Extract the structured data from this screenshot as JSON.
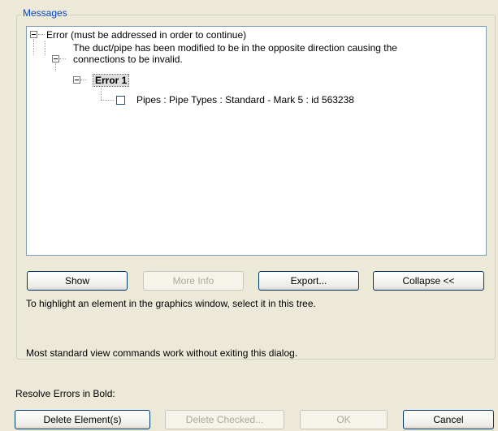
{
  "messages_group": {
    "title": "Messages"
  },
  "tree": {
    "root_label": "Error (must be addressed in order to continue)",
    "message_line1": "The duct/pipe has been modified to be in the opposite direction causing the",
    "message_line2": "connections to be invalid.",
    "error_label": "Error 1",
    "element_label": "Pipes : Pipe Types : Standard - Mark 5 : id 563238",
    "element_checked": false
  },
  "buttons": {
    "show": "Show",
    "more_info": "More Info",
    "export": "Export...",
    "collapse": "Collapse <<"
  },
  "hints": {
    "line1": "To highlight an element in the graphics window, select it in this tree.",
    "line2": "Most standard view commands work without exiting this dialog."
  },
  "resolve": {
    "label": "Resolve Errors in Bold:",
    "delete_elements": "Delete Element(s)",
    "delete_checked": "Delete Checked...",
    "ok": "OK",
    "cancel": "Cancel"
  }
}
